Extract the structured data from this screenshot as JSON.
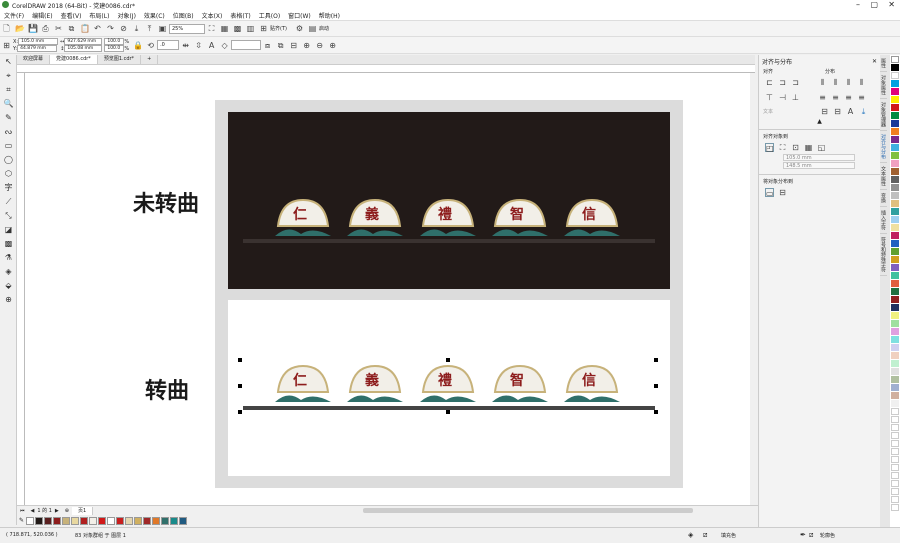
{
  "window": {
    "title": "CorelDRAW 2018 (64-Bit) - 党建0086.cdr*"
  },
  "menu": [
    "文件(F)",
    "编辑(E)",
    "查看(V)",
    "布局(L)",
    "对象(J)",
    "效果(C)",
    "位图(B)",
    "文本(X)",
    "表格(T)",
    "工具(O)",
    "窗口(W)",
    "帮助(H)"
  ],
  "toolbar": {
    "zoom": "25%",
    "snap": "贴齐(T)",
    "launch": "启动"
  },
  "propbar": {
    "x": "105.0 mm",
    "y": "44.879 mm",
    "w": "927.629 mm",
    "h": "105.08 mm",
    "sx": "100.0",
    "sy": "100.0",
    "pct": "%",
    "angle": ".0"
  },
  "tabs": [
    "欢迎屏幕",
    "党建0086.cdr*",
    "预览图1.cdr*"
  ],
  "canvas": {
    "label_top": "未转曲",
    "label_bottom": "转曲",
    "fan_chars": [
      "仁",
      "義",
      "禮",
      "智",
      "信"
    ]
  },
  "pager": {
    "page_of": "1 的 1",
    "page_tab": "页1"
  },
  "status": {
    "coords": "( 718.871, 520.036 )",
    "info": "83 对象群组 于 图层 1",
    "fill": "填充色",
    "outline": "轮廓色"
  },
  "docker": {
    "title": "对齐与分布",
    "align": "对齐",
    "distribute": "分布",
    "text": "文本",
    "align_to": "对齐对象到",
    "dim1": "105.0 mm",
    "dim2": "148.5 mm",
    "distribute_to": "将对象分布到"
  },
  "docker_tabs": [
    "属性",
    "对象属性",
    "对象管理器",
    "对齐与分布",
    "文本属性",
    "变换",
    "插入字符",
    "符号和特殊字符"
  ],
  "colors": {
    "accent": "#8d1c1c",
    "dark_bg": "#221a18"
  }
}
